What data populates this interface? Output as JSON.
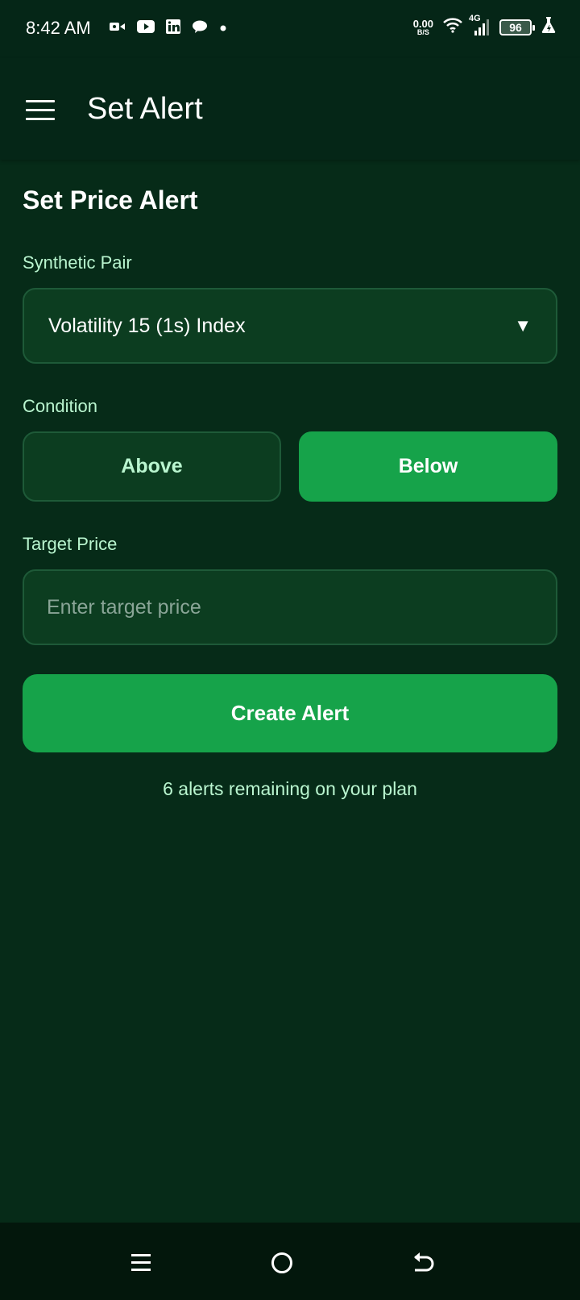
{
  "status_bar": {
    "time": "8:42 AM",
    "net_speed_value": "0.00",
    "net_speed_unit": "B/S",
    "network_type": "4G",
    "battery_level": "96",
    "left_icons": [
      "video-camera-icon",
      "youtube-icon",
      "linkedin-icon",
      "chat-icon",
      "notification-dot-icon"
    ],
    "right_icons": [
      "wifi-icon",
      "signal-icon",
      "battery-icon",
      "flask-icon"
    ]
  },
  "app_bar": {
    "title": "Set Alert",
    "menu_icon": "hamburger-menu-icon"
  },
  "form": {
    "section_title": "Set Price Alert",
    "pair_label": "Synthetic Pair",
    "pair_value": "Volatility 15 (1s) Index",
    "pair_caret_icon": "caret-down-icon",
    "condition_label": "Condition",
    "condition_options": [
      "Above",
      "Below"
    ],
    "condition_selected": "Below",
    "target_label": "Target Price",
    "target_placeholder": "Enter target price",
    "target_value": "",
    "submit_label": "Create Alert",
    "remaining_text": "6 alerts remaining on your plan"
  },
  "nav_bar": {
    "buttons": [
      "recent-apps-icon",
      "home-icon",
      "back-icon"
    ]
  },
  "colors": {
    "background": "#062b18",
    "header": "#052617",
    "field_bg": "#0c3d20",
    "field_border": "#1e5a38",
    "accent": "#16a34a",
    "label": "#b9f5cf"
  }
}
